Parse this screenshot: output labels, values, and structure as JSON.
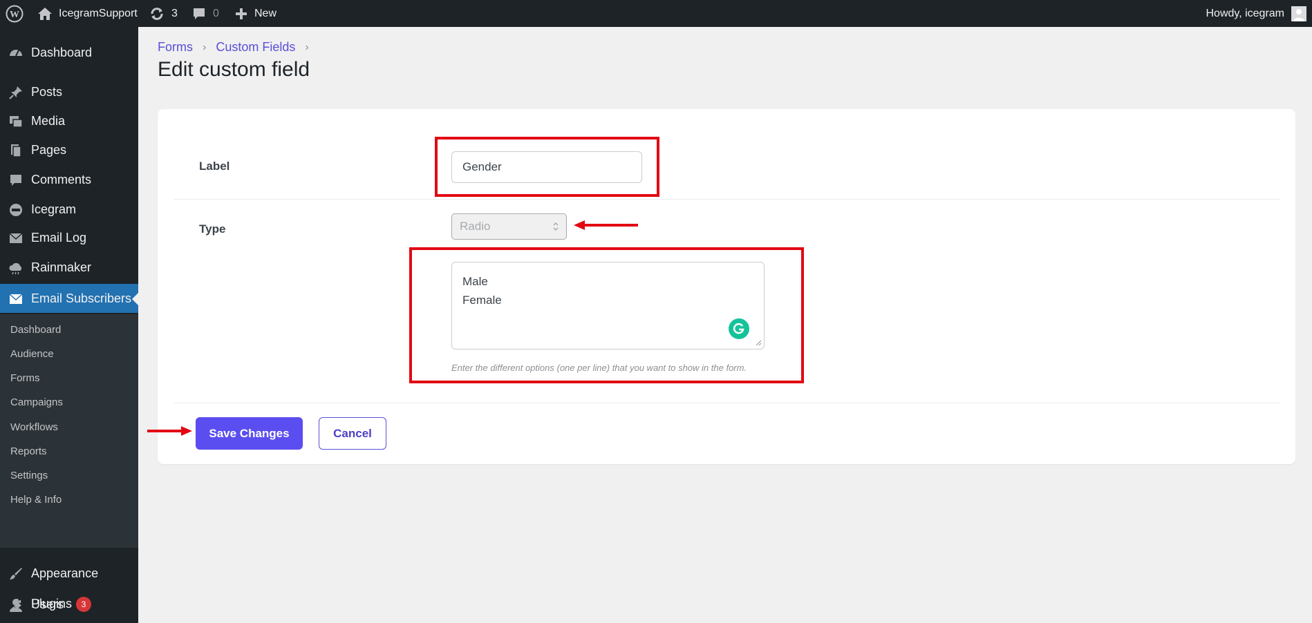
{
  "admin_bar": {
    "site_name": "IcegramSupport",
    "updates_count": "3",
    "comments_count": "0",
    "new_label": "New",
    "greeting": "Howdy, icegram"
  },
  "sidebar": {
    "items": [
      {
        "label": "Dashboard",
        "icon": "dashboard-icon"
      },
      {
        "label": "Posts",
        "icon": "pin-icon"
      },
      {
        "label": "Media",
        "icon": "media-icon"
      },
      {
        "label": "Pages",
        "icon": "pages-icon"
      },
      {
        "label": "Comments",
        "icon": "comment-icon"
      },
      {
        "label": "Icegram",
        "icon": "icegram-icon"
      },
      {
        "label": "Email Log",
        "icon": "envelope-icon"
      },
      {
        "label": "Rainmaker",
        "icon": "cloud-icon"
      },
      {
        "label": "Email Subscribers",
        "icon": "envelope-icon"
      }
    ],
    "submenu": [
      "Dashboard",
      "Audience",
      "Forms",
      "Campaigns",
      "Workflows",
      "Reports",
      "Settings",
      "Help & Info"
    ],
    "bottom_items": [
      {
        "label": "Appearance",
        "icon": "brush-icon"
      },
      {
        "label": "Plugins",
        "icon": "plug-icon",
        "badge": "3"
      },
      {
        "label": "Users",
        "icon": "user-icon"
      }
    ]
  },
  "breadcrumb": [
    "Forms",
    "Custom Fields"
  ],
  "page_title": "Edit custom field",
  "form": {
    "label_field_label": "Label",
    "label_value": "Gender",
    "type_field_label": "Type",
    "type_value": "Radio",
    "options_lines": [
      "Male",
      "Female"
    ],
    "help_text": "Enter the different options (one per line) that you want to show in the form.",
    "save_label": "Save Changes",
    "cancel_label": "Cancel"
  },
  "colors": {
    "primary": "#5b4ef0",
    "admin_bg": "#1d2327",
    "current_menu": "#2271b1",
    "annotation": "#e30613"
  }
}
